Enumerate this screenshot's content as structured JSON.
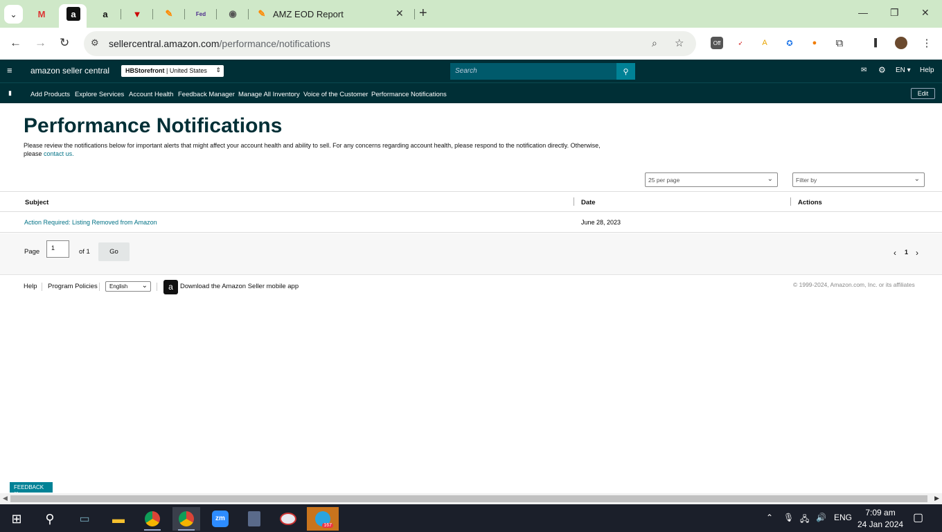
{
  "browser": {
    "tab_title": "AMZ EOD Report",
    "url_host": "sellercentral.amazon.com",
    "url_path": "/performance/notifications"
  },
  "header": {
    "logo": "amazon seller central",
    "store_name": "HBStorefront",
    "store_region": "United States",
    "search_placeholder": "Search",
    "lang": "EN",
    "help": "Help"
  },
  "nav": {
    "items": [
      "Add Products",
      "Explore Services",
      "Account Health",
      "Feedback Manager",
      "Manage All Inventory",
      "Voice of the Customer",
      "Performance Notifications"
    ],
    "edit": "Edit"
  },
  "page": {
    "title": "Performance Notifications",
    "description": "Please review the notifications below for important alerts that might affect your account health and ability to sell. For any concerns regarding account health, please respond to the notification directly. Otherwise, please",
    "contact_link": "contact us.",
    "per_page": "25 per page",
    "filter": "Filter by"
  },
  "table": {
    "headers": [
      "Subject",
      "Date",
      "Actions"
    ],
    "rows": [
      {
        "subject": "Action Required: Listing Removed from Amazon",
        "date": "June 28, 2023",
        "actions": ""
      }
    ]
  },
  "pager": {
    "page_label": "Page",
    "page_value": "1",
    "of_label": "of 1",
    "go": "Go",
    "current": "1"
  },
  "footer": {
    "help": "Help",
    "policies": "Program Policies",
    "language": "English",
    "app_text": "Download the Amazon Seller mobile app",
    "copyright": "© 1999-2024, Amazon.com, Inc. or its affiliates"
  },
  "feedback": "FEEDBACK",
  "taskbar": {
    "lang": "ENG",
    "time": "7:09 am",
    "date": "24 Jan 2024",
    "telegram_badge": "167"
  }
}
